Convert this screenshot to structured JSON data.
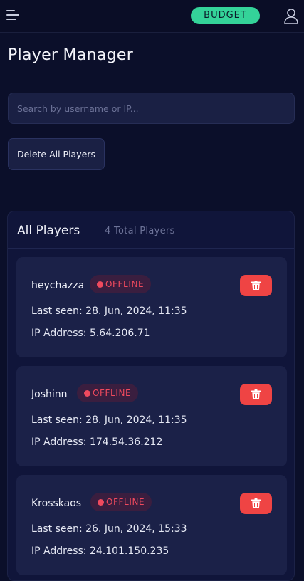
{
  "header": {
    "budget_label": "BUDGET"
  },
  "page": {
    "title": "Player Manager"
  },
  "search": {
    "placeholder": "Search by username or IP...",
    "value": ""
  },
  "actions": {
    "delete_all_label": "Delete All Players"
  },
  "panel": {
    "title": "All Players",
    "count_label": "4 Total Players"
  },
  "players": [
    {
      "name": "heychazza",
      "status": "OFFLINE",
      "last_seen": "Last seen: 28. Jun, 2024, 11:35",
      "ip": "IP Address: 5.64.206.71"
    },
    {
      "name": "Joshinn",
      "status": "OFFLINE",
      "last_seen": "Last seen: 28. Jun, 2024, 11:35",
      "ip": "IP Address: 174.54.36.212"
    },
    {
      "name": "Krosskaos",
      "status": "OFFLINE",
      "last_seen": "Last seen: 26. Jun, 2024, 15:33",
      "ip": "IP Address: 24.101.150.235"
    }
  ],
  "icons": {
    "menu": "menu-icon",
    "user": "user-icon",
    "trash": "trash-icon",
    "status_dot": "status-dot-icon"
  },
  "colors": {
    "background": "#0b0f2a",
    "budget_accent": "#34d399",
    "offline": "#f04a5e",
    "delete": "#ef4444"
  }
}
